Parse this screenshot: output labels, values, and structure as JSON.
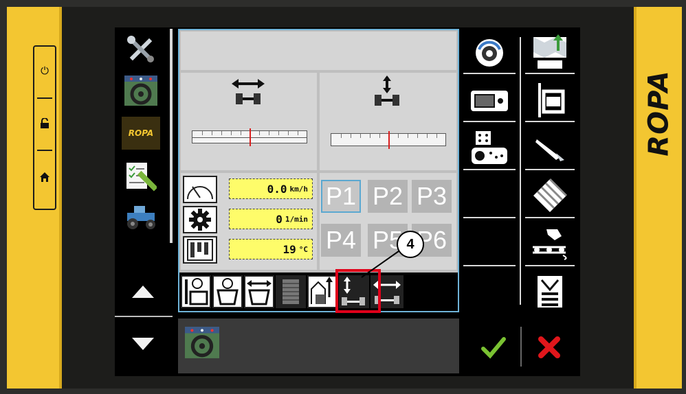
{
  "brand": {
    "name": "ROPA"
  },
  "hardware_buttons": [
    {
      "icon": "power-icon",
      "glyph": "⏻"
    },
    {
      "icon": "unlock-icon",
      "glyph": "🔓"
    },
    {
      "icon": "home-icon",
      "glyph": "⌂"
    }
  ],
  "left_menu": {
    "items": [
      {
        "icon": "settings-tools-icon"
      },
      {
        "icon": "steering-wheel-icon"
      },
      {
        "icon": "ropa-logo-icon",
        "label": "ROPA"
      },
      {
        "icon": "checklist-icon"
      },
      {
        "icon": "tractor-icon"
      }
    ],
    "scroll_up": "up-arrow-icon",
    "scroll_down": "down-arrow-icon"
  },
  "main": {
    "header_title": "",
    "indicator_left": {
      "icon": "lateral-shift-icon",
      "value_fraction": 0.5
    },
    "indicator_right": {
      "icon": "height-adjust-icon",
      "value_fraction": 0.5
    },
    "readouts": [
      {
        "icon": "speedometer-icon",
        "value": "0.0",
        "unit": "km/h"
      },
      {
        "icon": "gear-icon",
        "value": "0",
        "unit": "1/min"
      },
      {
        "icon": "temperature-gauge-icon",
        "value": "19",
        "unit": "°C"
      }
    ],
    "presets": [
      "P1",
      "P2",
      "P3",
      "P4",
      "P5",
      "P6"
    ],
    "selected_preset": "P1",
    "bottom_bar": [
      {
        "icon": "topper-adjust-icon"
      },
      {
        "icon": "cleaner-icon"
      },
      {
        "icon": "width-adjust-icon"
      },
      {
        "icon": "grid-scale-icon"
      },
      {
        "icon": "lift-arm-icon",
        "highlighted": true
      },
      {
        "icon": "height-axle-icon"
      },
      {
        "icon": "shift-axle-icon"
      }
    ]
  },
  "right_menu": {
    "items": [
      {
        "icon": "rotation-gear-icon"
      },
      {
        "icon": "map-navigation-icon"
      },
      {
        "icon": "display-device-icon"
      },
      {
        "icon": "rear-loader-icon"
      },
      {
        "icon": "control-panel-icon"
      },
      {
        "icon": "knife-icon"
      },
      {
        "icon": "empty"
      },
      {
        "icon": "pattern-diamond-icon"
      },
      {
        "icon": "empty"
      },
      {
        "icon": "conveyor-icon"
      },
      {
        "icon": "empty"
      },
      {
        "icon": "bunker-icon"
      }
    ]
  },
  "footer": {
    "info_icon": "steering-wheel-icon",
    "confirm_icon": "check-icon",
    "cancel_icon": "cross-icon"
  },
  "callout": {
    "number": "4"
  },
  "colors": {
    "yellow_frame": "#f3c631",
    "screen_bg": "#000000",
    "panel_border": "#6fb3d8",
    "readout_bg": "#fefc6a",
    "highlight": "#e0001a",
    "confirm": "#7ac232",
    "cancel": "#e0161b"
  }
}
